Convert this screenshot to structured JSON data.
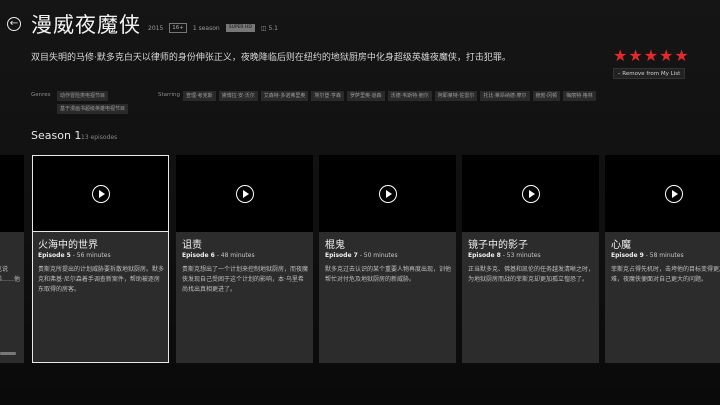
{
  "show": {
    "title": "漫威夜魔侠",
    "year": "2015",
    "rating": "16+",
    "seasons": "1 season",
    "quality": "SUPER HD",
    "audio": "5.1",
    "description": "双目失明的马修·默多克白天以律师的身份伸张正义，夜晚降临后则在纽约的地狱厨房中化身超级英雄夜魔侠，打击犯罪。",
    "user_rating": 5,
    "remove_label": "– Remove from My List"
  },
  "genres": {
    "label": "Genres",
    "items": [
      "动作冒险类电视节目",
      "基于漫画书超级英雄电视节目"
    ]
  },
  "starring": {
    "label": "Starring",
    "items": [
      "查理·考克斯",
      "黛博拉·安·沃尔",
      "艾森特·多诺弗里奥",
      "埃尔登·亨森",
      "罗萨里奥·道森",
      "沃德·韦斯特·鲍尔",
      "阿耶莱特·佐雷尔",
      "托比·莱昂纳德·摩尔",
      "鲍勃·冈顿",
      "梅丽特·格林"
    ]
  },
  "season": {
    "label": "Season 1",
    "count": "13 episodes"
  },
  "prev_episode": {
    "title": "",
    "desc": "……克兰克说的……兄弟……他的……"
  },
  "episodes": [
    {
      "title": "火海中的世界",
      "num": "Episode 5",
      "dur": " - 56 minutes",
      "desc": "贵斯克所提出的计划威胁要拆散地狱厨房。默多克和弗基·尼尔森着手调查新案件，帮助被逐房东取得的房客。",
      "selected": true
    },
    {
      "title": "诅责",
      "num": "Episode 6",
      "dur": " - 48 minutes",
      "desc": "贵斯克想出了一个计划来控制地狱厨房，而夜魔侠发现自己受困于这个计划的影响，本·乌里希尚找出真相更进了。",
      "selected": false
    },
    {
      "title": "棍鬼",
      "num": "Episode 7",
      "dur": " - 50 minutes",
      "desc": "默多克过去认识的某个重要人物再度出现，训他帮忙对付危及地狱厨房的新威胁。",
      "selected": false
    },
    {
      "title": "镜子中的影子",
      "num": "Episode 8",
      "dur": " - 53 minutes",
      "desc": "正当默多克、佛基和凯伦的任务越发清晰之时，为地狱厨房而战的菲斯克却更加孤立惶恐了。",
      "selected": false
    },
    {
      "title": "心魔",
      "num": "Episode 9",
      "dur": " - 58 minutes",
      "desc": "菲斯克占得先机时，击垮他的目标变得更加艰难，夜魔侠便面对自己更大的问题。",
      "selected": false
    }
  ]
}
